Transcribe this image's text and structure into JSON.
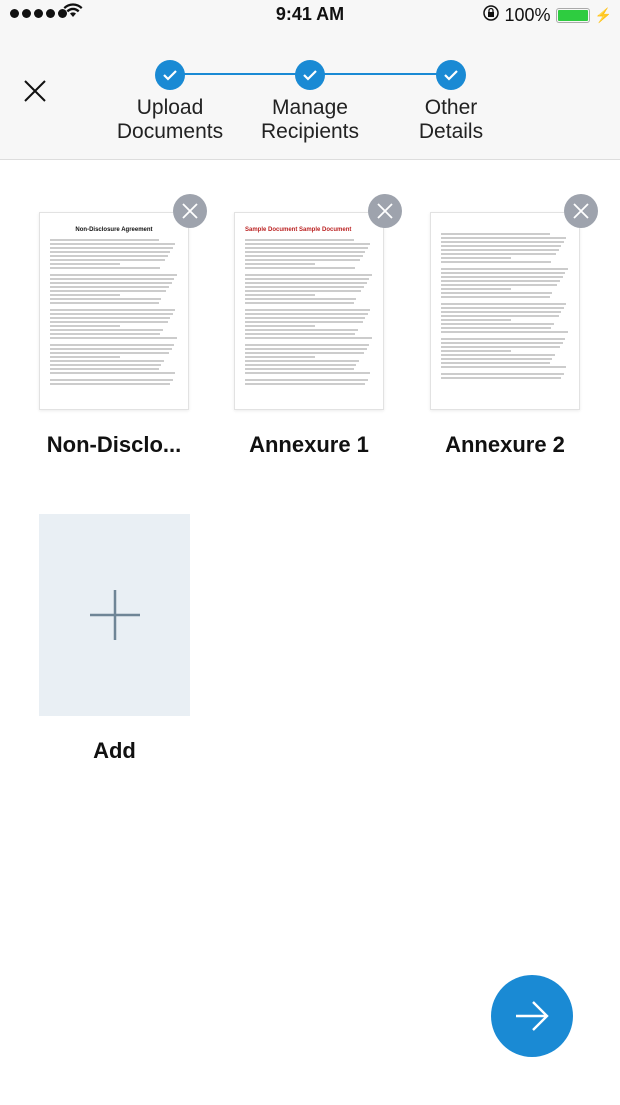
{
  "status_bar": {
    "time": "9:41 AM",
    "battery": "100%",
    "battery_level": 1.0,
    "icons": [
      "signal-icon",
      "wifi-icon",
      "rotation-lock-icon",
      "battery-icon",
      "charging-icon"
    ]
  },
  "header": {
    "close_icon": "close-icon",
    "accent": "#1a8ad4",
    "steps": [
      {
        "label_1": "Upload",
        "label_2": "Documents",
        "completed": true
      },
      {
        "label_1": "Manage",
        "label_2": "Recipients",
        "completed": true
      },
      {
        "label_1": "Other",
        "label_2": "Details",
        "completed": true
      }
    ]
  },
  "documents": [
    {
      "name": "Non-Disclo...",
      "thumb_title": "Non-Disclosure Agreement"
    },
    {
      "name": "Annexure 1",
      "thumb_title": "Sample Document  Sample Document"
    },
    {
      "name": "Annexure 2",
      "thumb_title": ""
    }
  ],
  "add": {
    "label": "Add",
    "icon": "plus-icon"
  },
  "next_button": {
    "icon": "arrow-right-icon"
  }
}
